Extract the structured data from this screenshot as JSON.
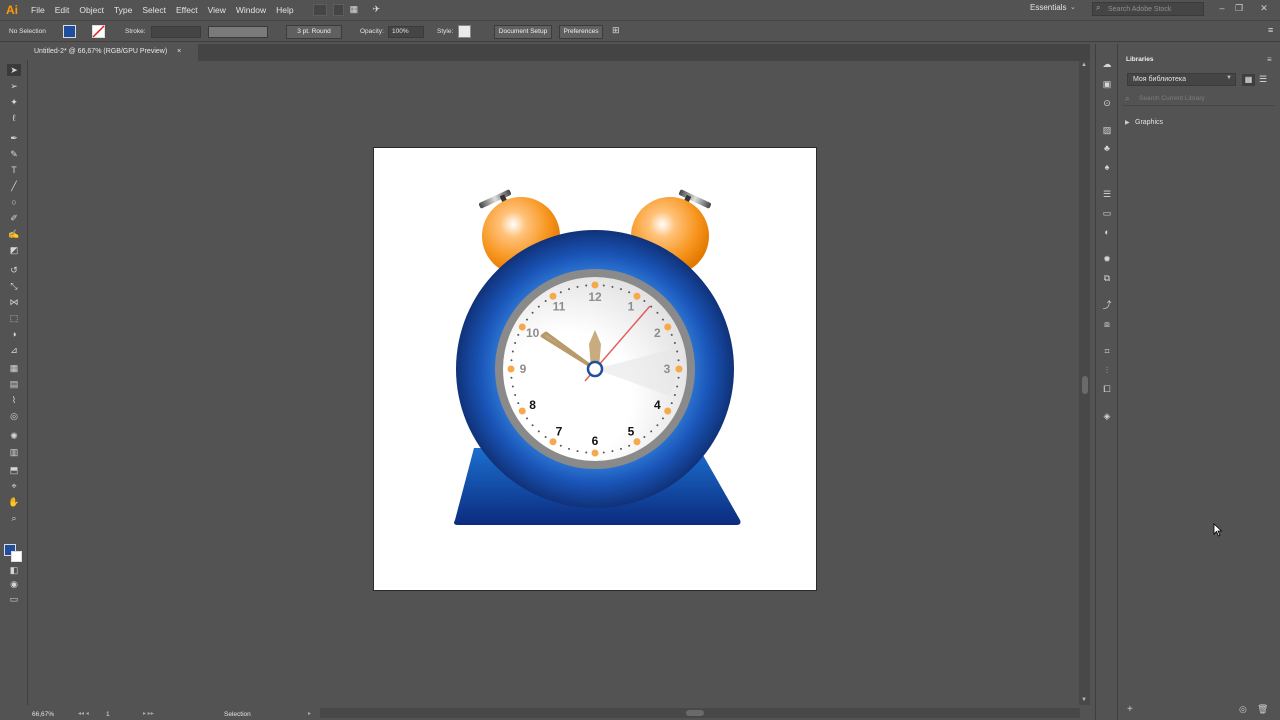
{
  "app": {
    "logo": "Ai"
  },
  "menu": [
    "File",
    "Edit",
    "Object",
    "Type",
    "Select",
    "Effect",
    "View",
    "Window",
    "Help"
  ],
  "workspace": "Essentials",
  "stock_search_placeholder": "Search Adobe Stock",
  "control": {
    "selection_label": "No Selection",
    "stroke_label": "Stroke:",
    "brush_label": "3 pt. Round",
    "opacity_label": "Opacity:",
    "opacity_value": "100%",
    "style_label": "Style:",
    "doc_setup": "Document Setup",
    "preferences": "Preferences",
    "fill_color": "#1f4f9c"
  },
  "document": {
    "tab_title": "Untitled-2* @ 66,67% (RGB/GPU Preview)",
    "close": "×"
  },
  "status": {
    "zoom": "66,67%",
    "artboard": "1",
    "tool": "Selection"
  },
  "libraries": {
    "title": "Libraries",
    "library_name": "Моя библиотека",
    "search_placeholder": "Search Current Library",
    "section": "Graphics"
  },
  "clock": {
    "numbers": [
      "12",
      "1",
      "2",
      "3",
      "4",
      "5",
      "6",
      "7",
      "8",
      "9",
      "10",
      "11"
    ],
    "time_display": "10:05"
  },
  "tools": [
    "selection-tool",
    "direct-selection-tool",
    "magic-wand-tool",
    "lasso-tool",
    "pen-tool",
    "curvature-tool",
    "type-tool",
    "line-tool",
    "ellipse-tool",
    "paintbrush-tool",
    "shaper-tool",
    "eraser-tool",
    "rotate-tool",
    "scale-tool",
    "width-tool",
    "free-transform-tool",
    "shape-builder-tool",
    "perspective-tool",
    "mesh-tool",
    "gradient-tool",
    "eyedropper-tool",
    "blend-tool",
    "symbol-sprayer-tool",
    "graph-tool",
    "artboard-tool",
    "slice-tool",
    "hand-tool",
    "zoom-tool"
  ]
}
